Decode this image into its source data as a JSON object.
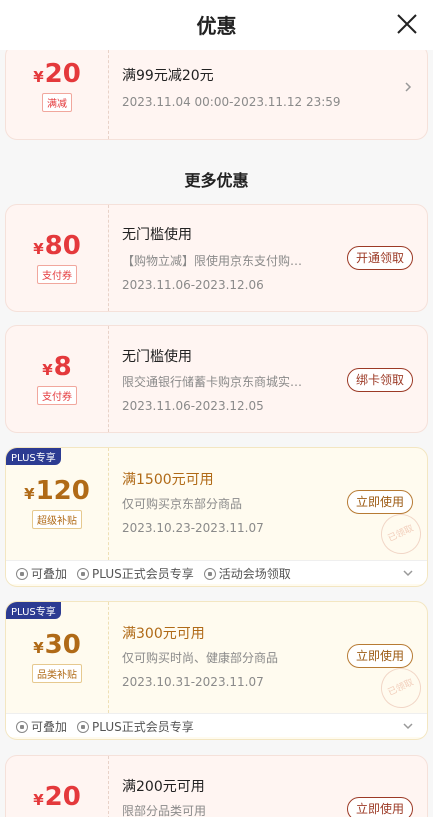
{
  "header": {
    "title": "优惠"
  },
  "section_title": "更多优惠",
  "top_coupon": {
    "yen": "¥",
    "amount": "20",
    "tag": "满减",
    "title": "满99元减20元",
    "validity": "2023.11.04 00:00-2023.11.12 23:59"
  },
  "coupons": [
    {
      "yen": "¥",
      "amount": "80",
      "tag": "支付券",
      "title": "无门槛使用",
      "desc": "【购物立减】限使用京东支付购…",
      "validity": "2023.11.06-2023.12.06",
      "button": "开通领取"
    },
    {
      "yen": "¥",
      "amount": "8",
      "tag": "支付券",
      "title": "无门槛使用",
      "desc": "限交通银行储蓄卡购京东商城实…",
      "validity": "2023.11.06-2023.12.05",
      "button": "绑卡领取"
    },
    {
      "badge": "PLUS专享",
      "yen": "¥",
      "amount": "120",
      "tag": "超级补贴",
      "title": "满1500元可用",
      "desc": "仅可购买京东部分商品",
      "validity": "2023.10.23-2023.11.07",
      "button": "立即使用",
      "stamp": "已领取",
      "footer": [
        "可叠加",
        "PLUS正式会员专享",
        "活动会场领取"
      ]
    },
    {
      "badge": "PLUS专享",
      "yen": "¥",
      "amount": "30",
      "tag": "品类补贴",
      "title": "满300元可用",
      "desc": "仅可购买时尚、健康部分商品",
      "validity": "2023.10.31-2023.11.07",
      "button": "立即使用",
      "stamp": "已领取",
      "footer": [
        "可叠加",
        "PLUS正式会员专享"
      ]
    },
    {
      "yen": "¥",
      "amount": "20",
      "title": "满200元可用",
      "desc": "限部分品类可用",
      "button": "立即使用"
    }
  ],
  "colors": {
    "red_accent": "#e4393c",
    "gold_accent": "#b06a17",
    "plus_badge": "#2c3b92"
  }
}
